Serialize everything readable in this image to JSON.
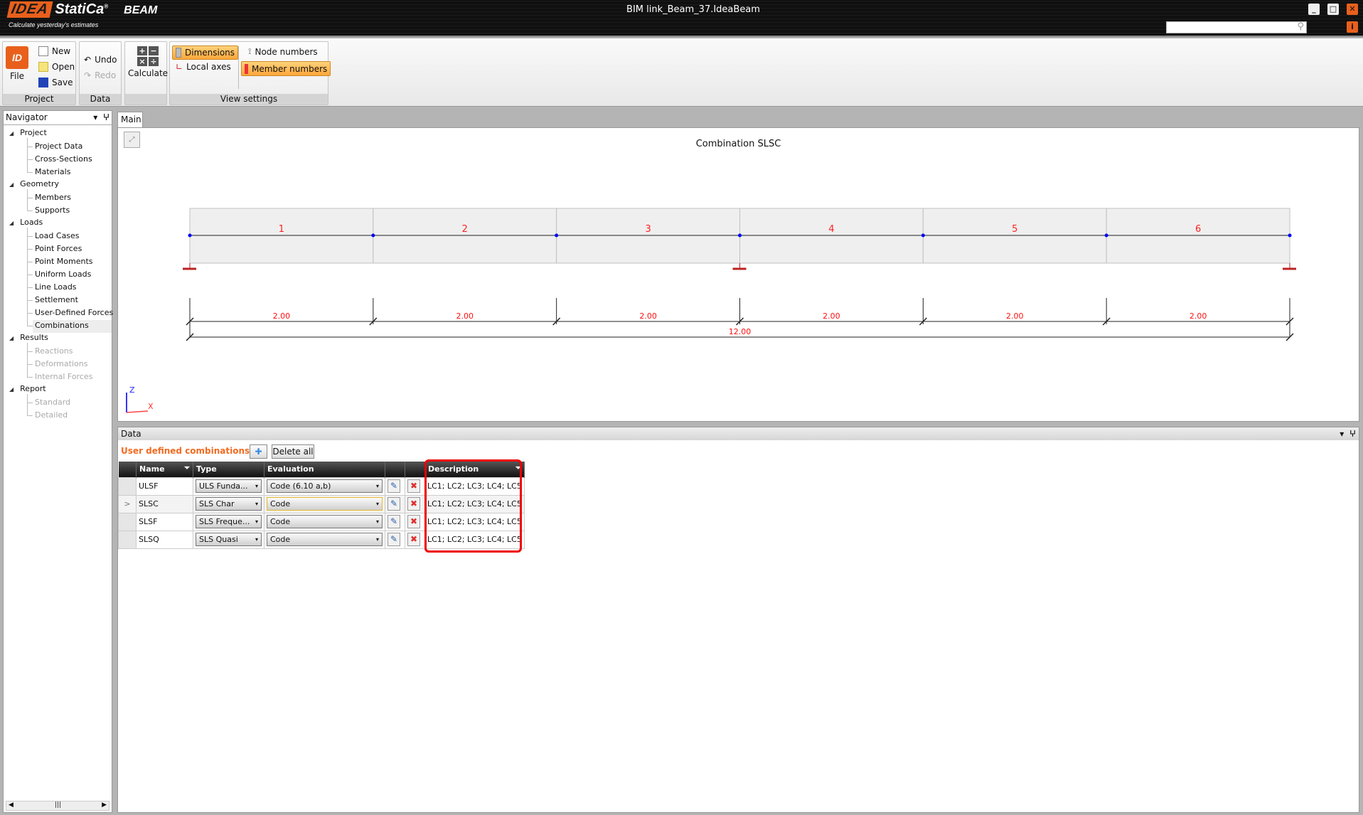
{
  "app": {
    "brand": "IDEA",
    "product": "StatiCa",
    "module": "BEAM",
    "slogan": "Calculate yesterday's estimates",
    "title": "BIM link_Beam_37.IdeaBeam",
    "search_placeholder": ""
  },
  "ribbon": {
    "project": {
      "label": "Project",
      "file": "File",
      "new": "New",
      "open": "Open",
      "save": "Save"
    },
    "data": {
      "label": "Data",
      "undo": "Undo",
      "redo": "Redo"
    },
    "calc": {
      "calculate": "Calculate"
    },
    "view": {
      "label": "View settings",
      "dimensions": "Dimensions",
      "local_axes": "Local axes",
      "node_numbers": "Node numbers",
      "member_numbers": "Member numbers"
    }
  },
  "navigator": {
    "title": "Navigator",
    "tree": [
      {
        "label": "Project",
        "children": [
          {
            "label": "Project Data"
          },
          {
            "label": "Cross-Sections"
          },
          {
            "label": "Materials"
          }
        ]
      },
      {
        "label": "Geometry",
        "children": [
          {
            "label": "Members"
          },
          {
            "label": "Supports"
          }
        ]
      },
      {
        "label": "Loads",
        "children": [
          {
            "label": "Load Cases"
          },
          {
            "label": "Point Forces"
          },
          {
            "label": "Point Moments"
          },
          {
            "label": "Uniform Loads"
          },
          {
            "label": "Line Loads"
          },
          {
            "label": "Settlement"
          },
          {
            "label": "User-Defined Forces"
          },
          {
            "label": "Combinations",
            "selected": true
          }
        ]
      },
      {
        "label": "Results",
        "children": [
          {
            "label": "Reactions",
            "disabled": true
          },
          {
            "label": "Deformations",
            "disabled": true
          },
          {
            "label": "Internal Forces",
            "disabled": true
          }
        ]
      },
      {
        "label": "Report",
        "children": [
          {
            "label": "Standard",
            "disabled": true
          },
          {
            "label": "Detailed",
            "disabled": true
          }
        ]
      }
    ]
  },
  "main": {
    "tab": "Main",
    "title": "Combination SLSC",
    "members": [
      "1",
      "2",
      "3",
      "4",
      "5",
      "6"
    ],
    "spans": [
      "2.00",
      "2.00",
      "2.00",
      "2.00",
      "2.00",
      "2.00"
    ],
    "total": "12.00",
    "supports_at_nodes": [
      0,
      3,
      6
    ],
    "axis_z": "Z",
    "axis_x": "X"
  },
  "data_panel": {
    "title": "Data",
    "section": "User defined combinations",
    "delete_all": "Delete all",
    "columns": {
      "name": "Name",
      "type": "Type",
      "evaluation": "Evaluation",
      "description": "Description"
    },
    "rows": [
      {
        "name": "ULSF",
        "type": "ULS Funda...",
        "evaluation": "Code (6.10 a,b)",
        "description": "LC1; LC2; LC3; LC4; LC5"
      },
      {
        "name": "SLSC",
        "type": "SLS Char",
        "evaluation": "Code",
        "description": "LC1; LC2; LC3; LC4; LC5",
        "current": true
      },
      {
        "name": "SLSF",
        "type": "SLS Freque...",
        "evaluation": "Code",
        "description": "LC1; LC2; LC3; LC4; LC5"
      },
      {
        "name": "SLSQ",
        "type": "SLS Quasi",
        "evaluation": "Code",
        "description": "LC1; LC2; LC3; LC4; LC5"
      }
    ]
  },
  "colors": {
    "accent": "#e8601c",
    "member_label": "#ff2020",
    "node": "#0000ff",
    "highlight": "#e00000"
  }
}
